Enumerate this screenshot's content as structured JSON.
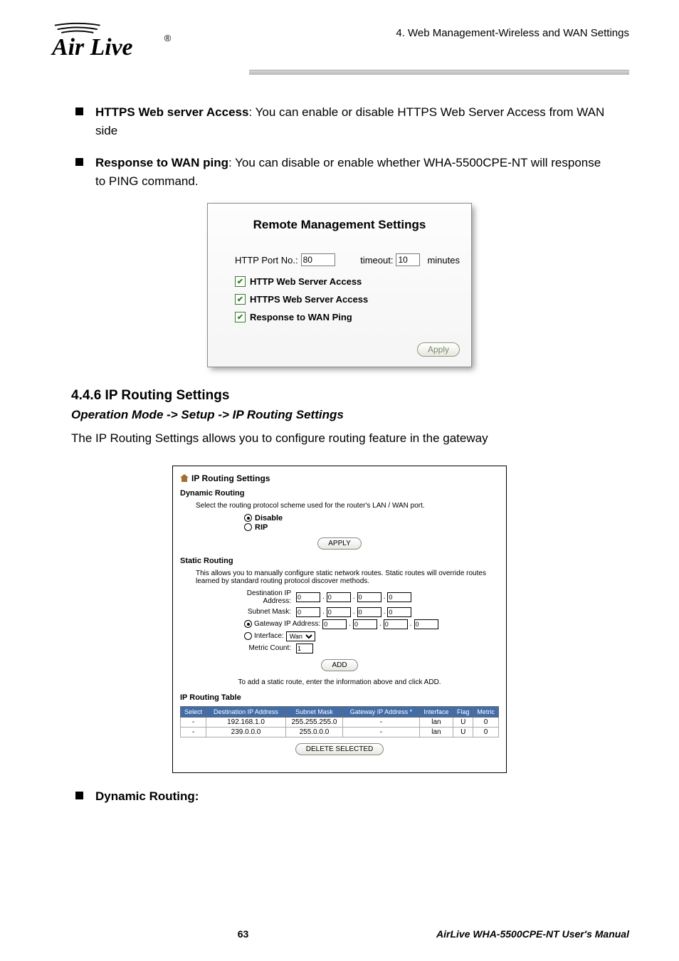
{
  "header": {
    "right_text": "4. Web Management-Wireless and WAN Settings",
    "brand": "AirLive"
  },
  "bullets": {
    "b1_label": "HTTPS Web server Access",
    "b1_text": ":   You can enable or disable HTTPS Web Server Access from WAN side",
    "b2_label": "Response to WAN ping",
    "b2_text": ":   You can disable or enable whether WHA-5500CPE-NT will response to PING command.",
    "b3_label": "Dynamic Routing:"
  },
  "panel1": {
    "title": "Remote Management Settings",
    "http_port_label": "HTTP Port No.:",
    "http_port_value": "80",
    "timeout_label": "timeout:",
    "timeout_value": "10",
    "timeout_unit": "minutes",
    "chk1": "HTTP Web Server Access",
    "chk2": "HTTPS Web Server Access",
    "chk3": "Response to WAN Ping",
    "apply": "Apply"
  },
  "section": {
    "heading": "4.4.6 IP Routing Settings",
    "opmode": "Operation Mode -> Setup -> IP Routing Settings",
    "body": "The IP Routing Settings allows you to configure routing feature in the gateway"
  },
  "panel2": {
    "title": "IP Routing Settings",
    "dyn_heading": "Dynamic Routing",
    "dyn_text": "Select the routing protocol scheme used for the router's LAN / WAN port.",
    "radio_disable": "Disable",
    "radio_rip": "RIP",
    "apply": "APPLY",
    "stat_heading": "Static Routing",
    "stat_text": "This allows you to manually configure static network routes. Static routes will override routes learned by standard routing protocol discover methods.",
    "dest_label": "Destination IP Address:",
    "mask_label": "Subnet Mask:",
    "gw_label": "Gateway IP Address:",
    "if_label": "Interface:",
    "if_value": "Wan",
    "metric_label": "Metric Count:",
    "metric_value": "1",
    "ip_octet": "0",
    "add": "ADD",
    "add_note": "To add a static route, enter the information above and click ADD.",
    "table_heading": "IP Routing Table",
    "th": {
      "select": "Select",
      "dest": "Destination IP Address",
      "mask": "Subnet Mask",
      "gw": "Gateway IP Address *",
      "if": "Interface",
      "flag": "Flag",
      "metric": "Metric"
    },
    "rows": [
      {
        "select": "-",
        "dest": "192.168.1.0",
        "mask": "255.255.255.0",
        "gw": "-",
        "if": "lan",
        "flag": "U",
        "metric": "0"
      },
      {
        "select": "-",
        "dest": "239.0.0.0",
        "mask": "255.0.0.0",
        "gw": "-",
        "if": "lan",
        "flag": "U",
        "metric": "0"
      }
    ],
    "delete": "DELETE SELECTED"
  },
  "footer": {
    "page": "63",
    "manual": "AirLive WHA-5500CPE-NT User's Manual"
  }
}
